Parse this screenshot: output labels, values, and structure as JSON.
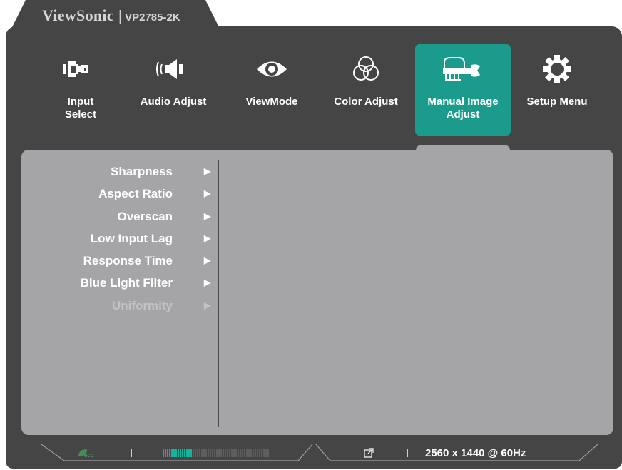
{
  "brand": {
    "name": "ViewSonic",
    "separator": "|",
    "model": "VP2785-2K"
  },
  "nav": [
    {
      "key": "input-select",
      "label": "Input Select",
      "icon": "input-select-icon"
    },
    {
      "key": "audio-adjust",
      "label": "Audio Adjust",
      "icon": "speaker-icon"
    },
    {
      "key": "viewmode",
      "label": "ViewMode",
      "icon": "eye-icon"
    },
    {
      "key": "color-adjust",
      "label": "Color Adjust",
      "icon": "color-circles-icon"
    },
    {
      "key": "manual-image-adjust",
      "label": "Manual Image Adjust",
      "icon": "hand-wrench-icon",
      "active": true
    },
    {
      "key": "setup-menu",
      "label": "Setup Menu",
      "icon": "gear-icon"
    }
  ],
  "menu": [
    {
      "label": "Sharpness",
      "enabled": true
    },
    {
      "label": "Aspect Ratio",
      "enabled": true
    },
    {
      "label": "Overscan",
      "enabled": true
    },
    {
      "label": "Low Input Lag",
      "enabled": true
    },
    {
      "label": "Response Time",
      "enabled": true
    },
    {
      "label": "Blue Light Filter",
      "enabled": true
    },
    {
      "label": "Uniformity",
      "enabled": false
    }
  ],
  "status": {
    "eco_icon": "eco-leaf-icon",
    "level_fraction": 0.27,
    "link_icon": "external-link-icon",
    "resolution": "2560 x 1440 @ 60Hz"
  },
  "colors": {
    "frame": "#454545",
    "active_tab": "#1a9b8b",
    "content_panel": "#a5a5a7",
    "disabled_text": "#c3c3c5",
    "level_fill": "#14b39d"
  }
}
